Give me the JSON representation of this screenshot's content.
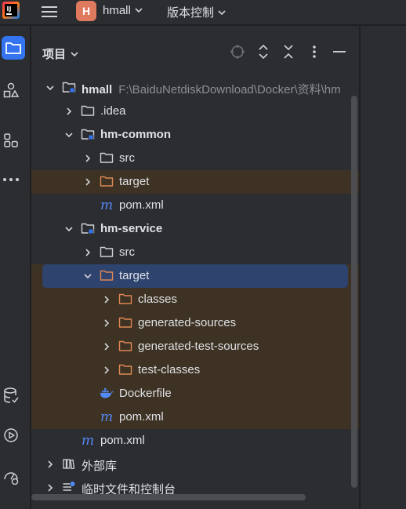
{
  "titlebar": {
    "project_badge": "H",
    "project_name": "hmall",
    "vcs_label": "版本控制"
  },
  "panel": {
    "title": "项目"
  },
  "tree": [
    {
      "label": "hmall",
      "path": "F:\\BaiduNetdiskDownload\\Docker\\资料\\hm",
      "icon": "module-folder-icon",
      "expanded": true,
      "bold": true
    },
    {
      "label": ".idea",
      "icon": "folder-icon",
      "expanded": false
    },
    {
      "label": "hm-common",
      "icon": "module-folder-icon",
      "expanded": true,
      "bold": true
    },
    {
      "label": "src",
      "icon": "folder-icon",
      "expanded": false
    },
    {
      "label": "target",
      "icon": "excluded-folder-icon",
      "expanded": false
    },
    {
      "label": "pom.xml",
      "icon": "maven-icon"
    },
    {
      "label": "hm-service",
      "icon": "module-folder-icon",
      "expanded": true,
      "bold": true
    },
    {
      "label": "src",
      "icon": "folder-icon",
      "expanded": false
    },
    {
      "label": "target",
      "icon": "excluded-folder-icon",
      "expanded": true
    },
    {
      "label": "classes",
      "icon": "excluded-folder-icon",
      "expanded": false
    },
    {
      "label": "generated-sources",
      "icon": "excluded-folder-icon",
      "expanded": false
    },
    {
      "label": "generated-test-sources",
      "icon": "excluded-folder-icon",
      "expanded": false
    },
    {
      "label": "test-classes",
      "icon": "excluded-folder-icon",
      "expanded": false
    },
    {
      "label": "Dockerfile",
      "icon": "docker-icon"
    },
    {
      "label": "pom.xml",
      "icon": "maven-icon"
    },
    {
      "label": "pom.xml",
      "icon": "maven-icon"
    },
    {
      "label": "外部库",
      "icon": "library-icon",
      "expanded": false
    },
    {
      "label": "临时文件和控制台",
      "icon": "scratches-icon",
      "expanded": false
    }
  ],
  "colors": {
    "accent": "#3574f0",
    "excluded_bg": "#3d3223",
    "selected_bg": "#2e436e",
    "badge": "#e07a5f"
  }
}
